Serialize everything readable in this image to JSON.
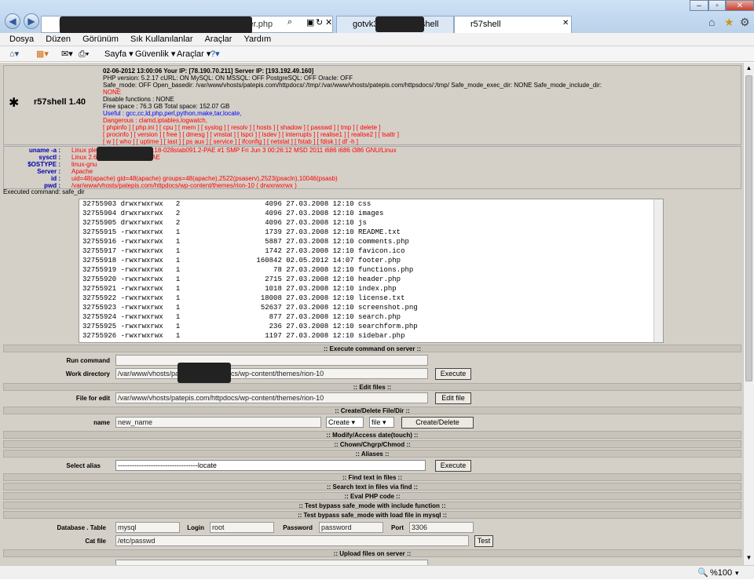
{
  "browser": {
    "address": "http://patepis.com/wp-content/themes/rion-10/footer.php",
    "tabs": [
      {
        "label": "gotvk3rex.net c99shell"
      },
      {
        "label": "r57shell"
      }
    ],
    "menu": [
      "Dosya",
      "Düzen",
      "Görünüm",
      "Sık Kullanılanlar",
      "Araçlar",
      "Yardım"
    ],
    "commands": [
      "Sayfa ▾",
      "Güvenlik ▾",
      "Araçlar ▾"
    ],
    "zoom": "%100"
  },
  "shell": {
    "title": "r57shell 1.40",
    "line1": "02-06-2012 13:00:06  Your IP: [78.190.70.211]  Server IP: [193.192.49.160]",
    "line2": "PHP version: 5.2.17  cURL: ON  MySQL: ON  MSSQL: OFF  PostgreSQL: OFF  Oracle: OFF",
    "line3": "Safe_mode: OFF  Open_basedir: /var/www/vhosts/patepis.com/httpdocs/:/tmp/:/var/www/vhosts/patepis.com/httpsdocs/:/tmp/  Safe_mode_exec_dir: NONE  Safe_mode_include_dir:",
    "line4": "NONE",
    "line5": "Disable functions : NONE",
    "line6": "Free space : 76.3 GB Total space: 152.07 GB",
    "line7": "Useful : gcc,cc,ld,php,perl,python,make,tar,locate,",
    "line8": "Dangerous : clamd,iptables,logwatch,",
    "line9": "[ phpinfo ]  [ php.ini ]  [ cpu ]  [ mem ]  [ syslog ]  [ resolv ]  [ hosts ]  [ shadow ]  [ passwd ]  [ tmp ]  [ delete ]",
    "line10": "[ procinfo ]  [ version ]  [ free ]  [ dmesg ]  [ vmstat ]  [ lspci ]  [ lsdev ]  [ interrupts ]  [ realise1 ]  [ realise2 ]  [ lsattr ]",
    "line11": "[ w ]  [ who ]  [ uptime ]  [ last ]  [ ps aux ]  [ service ]  [ ifconfig ]  [ netstat ]  [ fstab ]  [ fdisk ]  [ df -h ]"
  },
  "sysinfo": [
    {
      "label": "uname -a :",
      "value": "Linux plesk.domakin.com 2.6.18-028stab091.2-PAE #1 SMP Fri Jun 3 00:26:12 MSD 2011 i686 i686 i386 GNU/Linux"
    },
    {
      "label": "sysctl :",
      "value": "Linux 2.6.18-028stab091.2-PAE"
    },
    {
      "label": "$OSTYPE :",
      "value": "linux-gnu"
    },
    {
      "label": "Server :",
      "value": "Apache"
    },
    {
      "label": "id :",
      "value": "uid=48(apache) gid=48(apache) groups=48(apache),2522(psaserv),2523(psacln),10046(psasb)"
    },
    {
      "label": "pwd :",
      "value": "/var/www/vhosts/patepis.com/httpdocs/wp-content/themes/rion-10   ( drwxrwxrwx )"
    }
  ],
  "executed": "Executed command:  safe_dir",
  "listing": [
    "32755903 drwxrwxrwx   2                    4096 27.03.2008 12:10 css",
    "32755904 drwxrwxrwx   2                    4096 27.03.2008 12:10 images",
    "32755905 drwxrwxrwx   2                    4096 27.03.2008 12:10 js",
    "32755915 -rwxrwxrwx   1                    1739 27.03.2008 12:10 README.txt",
    "32755916 -rwxrwxrwx   1                    5887 27.03.2008 12:10 comments.php",
    "32755917 -rwxrwxrwx   1                    1742 27.03.2008 12:10 favicon.ico",
    "32755918 -rwxrwxrwx   1                  160842 02.05.2012 14:07 footer.php",
    "32755919 -rwxrwxrwx   1                      78 27.03.2008 12:10 functions.php",
    "32755920 -rwxrwxrwx   1                    2715 27.03.2008 12:10 header.php",
    "32755921 -rwxrwxrwx   1                    1018 27.03.2008 12:10 index.php",
    "32755922 -rwxrwxrwx   1                   18008 27.03.2008 12:10 license.txt",
    "32755923 -rwxrwxrwx   1                   52637 27.03.2008 12:10 screenshot.png",
    "32755924 -rwxrwxrwx   1                     877 27.03.2008 12:10 search.php",
    "32755925 -rwxrwxrwx   1                     236 27.03.2008 12:10 searchform.php",
    "32755926 -rwxrwxrwx   1                    1197 27.03.2008 12:10 sidebar.php"
  ],
  "sections": {
    "execute": ":: Execute command on server ::",
    "edit": ":: Edit files ::",
    "create": ":: Create/Delete File/Dir ::",
    "modify": ":: Modify/Access date(touch) ::",
    "chown": ":: Chown/Chgrp/Chmod ::",
    "aliases": ":: Aliases ::",
    "find": ":: Find text in files ::",
    "findvia": ":: Search text in files via find ::",
    "eval": ":: Eval PHP code ::",
    "bypass1": ":: Test bypass safe_mode with include function ::",
    "bypass2": ":: Test bypass safe_mode with load file in mysql ::",
    "upload": ":: Upload files on server ::"
  },
  "form": {
    "run_label": "Run command",
    "workdir_label": "Work directory",
    "workdir_value": "/var/www/vhosts/patepis.com/httpdocs/wp-content/themes/rion-10",
    "execute_btn": "Execute",
    "file_edit_label": "File for edit",
    "file_edit_value": "/var/www/vhosts/patepis.com/httpdocs/wp-content/themes/rion-10",
    "edit_btn": "Edit file",
    "name_label": "name",
    "name_value": "new_name",
    "create_sel": "Create",
    "file_sel": "file",
    "create_btn": "Create/Delete",
    "alias_label": "Select alias",
    "alias_value": "----------------------------------locate",
    "db_label": "Database . Table",
    "db_value": "mysql",
    "login_label": "Login",
    "login_value": "root",
    "pass_label": "Password",
    "pass_value": "password",
    "port_label": "Port",
    "port_value": "3306",
    "cat_label": "Cat file",
    "cat_value": "/etc/passwd",
    "test_btn": "Test"
  }
}
